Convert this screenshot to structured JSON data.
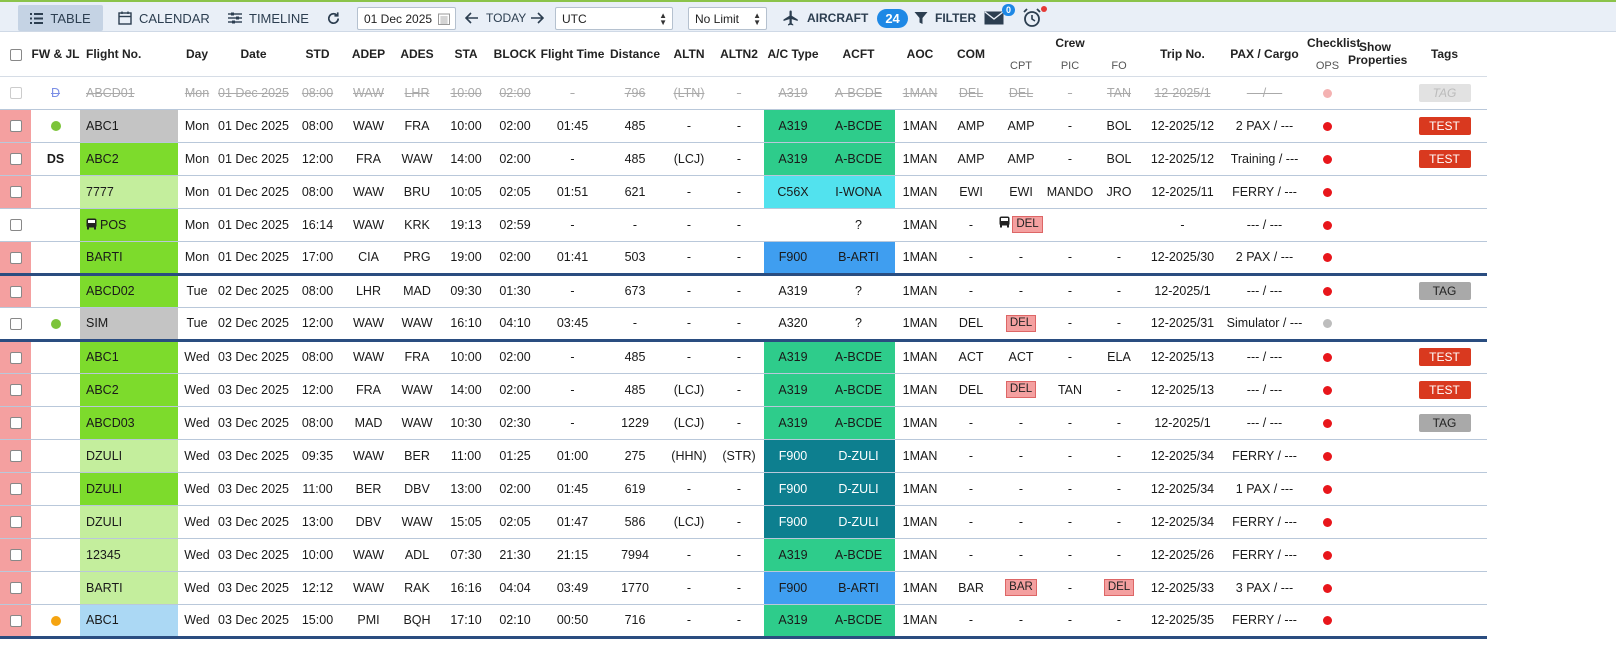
{
  "toolbar": {
    "table_label": "TABLE",
    "calendar_label": "CALENDAR",
    "timeline_label": "TIMELINE",
    "date_value": "01 Dec 2025",
    "today_label": "TODAY",
    "timezone_value": "UTC",
    "limit_value": "No Limit",
    "aircraft_label": "AIRCRAFT",
    "aircraft_count": "24",
    "filter_label": "FILTER",
    "mail_count": "0"
  },
  "headers": {
    "fwjl": "FW & JL",
    "flight": "Flight No.",
    "day": "Day",
    "date": "Date",
    "std": "STD",
    "adep": "ADEP",
    "ades": "ADES",
    "sta": "STA",
    "block": "BLOCK",
    "ftime": "Flight Time",
    "dist": "Distance",
    "altn": "ALTN",
    "altn2": "ALTN2",
    "actype": "A/C Type",
    "acft": "ACFT",
    "aoc": "AOC",
    "com": "COM",
    "crew": "Crew",
    "cpt": "CPT",
    "pic": "PIC",
    "fo": "FO",
    "trip": "Trip No.",
    "pax": "PAX / Cargo",
    "checklist": "Checklist",
    "ops": "OPS",
    "showprops": "Show Properties",
    "tags": "Tags"
  },
  "colors": {
    "flight_grey": "#c4c4c4",
    "flight_green": "#7ddb2c",
    "flight_lightgreen": "#c4ee9d",
    "flight_lightblue": "#abd8f4",
    "ac_green": "#2ecc8b",
    "ac_cyan": "#52e2ee",
    "ac_blue": "#3f9ef0",
    "ac_teal": "#0d7f8f",
    "status_red": "#e8161b",
    "status_grey": "#bdbdbd",
    "dot_green": "#7cc43a",
    "dot_orange": "#f5a410"
  },
  "rows": [
    {
      "sel": "white",
      "fw": "D",
      "fwtype": "text",
      "flight": "ABCD01",
      "fcolor": "none",
      "day": "Mon",
      "date": "01 Dec 2025",
      "std": "08:00",
      "adep": "WAW",
      "ades": "LHR",
      "sta": "10:00",
      "block": "02:00",
      "ftime": "-",
      "dist": "796",
      "altn": "(LTN)",
      "altn2": "-",
      "actype": "A319",
      "acft": "A-BCDE",
      "accolor": "none",
      "aoc": "1MAN",
      "com": "DEL",
      "cpt": "DEL",
      "pic": "-",
      "fo": "TAN",
      "trip": "12-2025/1",
      "pax": "--- / ---",
      "ck": "faint",
      "tag": "TAG",
      "tagtype": "faint",
      "cancelled": true,
      "end": false
    },
    {
      "sel": "red",
      "fw": "",
      "fwtype": "green",
      "flight": "ABC1",
      "fcolor": "grey",
      "day": "Mon",
      "date": "01 Dec 2025",
      "std": "08:00",
      "adep": "WAW",
      "ades": "FRA",
      "sta": "10:00",
      "block": "02:00",
      "ftime": "01:45",
      "dist": "485",
      "altn": "-",
      "altn2": "-",
      "actype": "A319",
      "acft": "A-BCDE",
      "accolor": "green",
      "aoc": "1MAN",
      "com": "AMP",
      "cpt": "AMP",
      "pic": "-",
      "fo": "BOL",
      "trip": "12-2025/12",
      "pax": "2 PAX / ---",
      "ck": "red",
      "tag": "TEST",
      "tagtype": "red",
      "end": false
    },
    {
      "sel": "red",
      "fw": "DS",
      "fwtype": "text",
      "flight": "ABC2",
      "fcolor": "green",
      "day": "Mon",
      "date": "01 Dec 2025",
      "std": "12:00",
      "adep": "FRA",
      "ades": "WAW",
      "sta": "14:00",
      "block": "02:00",
      "ftime": "-",
      "dist": "485",
      "altn": "(LCJ)",
      "altn2": "-",
      "actype": "A319",
      "acft": "A-BCDE",
      "accolor": "green",
      "aoc": "1MAN",
      "com": "AMP",
      "cpt": "AMP",
      "pic": "-",
      "fo": "BOL",
      "trip": "12-2025/12",
      "pax": "Training / ---",
      "ck": "red",
      "tag": "TEST",
      "tagtype": "red",
      "end": false
    },
    {
      "sel": "red",
      "fw": "",
      "fwtype": "none",
      "flight": "7777",
      "fcolor": "lightgreen",
      "day": "Mon",
      "date": "01 Dec 2025",
      "std": "08:00",
      "adep": "WAW",
      "ades": "BRU",
      "sta": "10:05",
      "block": "02:05",
      "ftime": "01:51",
      "dist": "621",
      "altn": "-",
      "altn2": "-",
      "actype": "C56X",
      "acft": "I-WONA",
      "accolor": "cyan",
      "aoc": "1MAN",
      "com": "EWI",
      "cpt": "EWI",
      "pic": "MANDO",
      "fo": "JRO",
      "trip": "12-2025/11",
      "pax": "FERRY / ---",
      "ck": "red",
      "tag": "",
      "tagtype": "none",
      "end": false
    },
    {
      "sel": "white",
      "fw": "",
      "fwtype": "none",
      "flight": "POS",
      "bus": true,
      "fcolor": "green",
      "day": "Mon",
      "date": "01 Dec 2025",
      "std": "16:14",
      "adep": "WAW",
      "ades": "KRK",
      "sta": "19:13",
      "block": "02:59",
      "ftime": "-",
      "dist": "-",
      "altn": "-",
      "altn2": "-",
      "actype": "",
      "acft": "?",
      "accolor": "none",
      "aoc": "1MAN",
      "com": "-",
      "cpt": "DEL",
      "cptbus": true,
      "cptdel": true,
      "pic": "",
      "fo": "",
      "trip": "-",
      "pax": "--- / ---",
      "ck": "red",
      "tag": "",
      "tagtype": "none",
      "end": false
    },
    {
      "sel": "red",
      "fw": "",
      "fwtype": "none",
      "flight": "BARTI",
      "fcolor": "green",
      "day": "Mon",
      "date": "01 Dec 2025",
      "std": "17:00",
      "adep": "CIA",
      "ades": "PRG",
      "sta": "19:00",
      "block": "02:00",
      "ftime": "01:41",
      "dist": "503",
      "altn": "-",
      "altn2": "-",
      "actype": "F900",
      "acft": "B-ARTI",
      "accolor": "blue",
      "aoc": "1MAN",
      "com": "-",
      "cpt": "-",
      "pic": "-",
      "fo": "-",
      "trip": "12-2025/30",
      "pax": "2 PAX / ---",
      "ck": "red",
      "tag": "",
      "tagtype": "none",
      "end": true
    },
    {
      "sel": "red",
      "fw": "",
      "fwtype": "none",
      "flight": "ABCD02",
      "fcolor": "green",
      "day": "Tue",
      "date": "02 Dec 2025",
      "std": "08:00",
      "adep": "LHR",
      "ades": "MAD",
      "sta": "09:30",
      "block": "01:30",
      "ftime": "-",
      "dist": "673",
      "altn": "-",
      "altn2": "-",
      "actype": "A319",
      "acft": "?",
      "accolor": "none",
      "aoc": "1MAN",
      "com": "-",
      "cpt": "-",
      "pic": "-",
      "fo": "-",
      "trip": "12-2025/1",
      "pax": "--- / ---",
      "ck": "red",
      "tag": "TAG",
      "tagtype": "grey",
      "end": false
    },
    {
      "sel": "white",
      "fw": "",
      "fwtype": "green",
      "flight": "SIM",
      "fcolor": "grey",
      "day": "Tue",
      "date": "02 Dec 2025",
      "std": "12:00",
      "adep": "WAW",
      "ades": "WAW",
      "sta": "16:10",
      "block": "04:10",
      "ftime": "03:45",
      "dist": "-",
      "altn": "-",
      "altn2": "-",
      "actype": "A320",
      "acft": "?",
      "accolor": "none",
      "aoc": "1MAN",
      "com": "DEL",
      "cpt": "DEL",
      "cptdel": true,
      "pic": "-",
      "fo": "-",
      "trip": "12-2025/31",
      "pax": "Simulator / ---",
      "ck": "grey",
      "tag": "",
      "tagtype": "none",
      "end": true
    },
    {
      "sel": "red",
      "fw": "",
      "fwtype": "none",
      "flight": "ABC1",
      "fcolor": "green",
      "day": "Wed",
      "date": "03 Dec 2025",
      "std": "08:00",
      "adep": "WAW",
      "ades": "FRA",
      "sta": "10:00",
      "block": "02:00",
      "ftime": "-",
      "dist": "485",
      "altn": "-",
      "altn2": "-",
      "actype": "A319",
      "acft": "A-BCDE",
      "accolor": "green",
      "aoc": "1MAN",
      "com": "ACT",
      "cpt": "ACT",
      "pic": "-",
      "fo": "ELA",
      "trip": "12-2025/13",
      "pax": "--- / ---",
      "ck": "red",
      "tag": "TEST",
      "tagtype": "red",
      "end": false
    },
    {
      "sel": "red",
      "fw": "",
      "fwtype": "none",
      "flight": "ABC2",
      "fcolor": "green",
      "day": "Wed",
      "date": "03 Dec 2025",
      "std": "12:00",
      "adep": "FRA",
      "ades": "WAW",
      "sta": "14:00",
      "block": "02:00",
      "ftime": "-",
      "dist": "485",
      "altn": "(LCJ)",
      "altn2": "-",
      "actype": "A319",
      "acft": "A-BCDE",
      "accolor": "green",
      "aoc": "1MAN",
      "com": "DEL",
      "cpt": "DEL",
      "cptdel": true,
      "pic": "TAN",
      "fo": "-",
      "trip": "12-2025/13",
      "pax": "--- / ---",
      "ck": "red",
      "tag": "TEST",
      "tagtype": "red",
      "end": false
    },
    {
      "sel": "red",
      "fw": "",
      "fwtype": "none",
      "flight": "ABCD03",
      "fcolor": "green",
      "day": "Wed",
      "date": "03 Dec 2025",
      "std": "08:00",
      "adep": "MAD",
      "ades": "WAW",
      "sta": "10:30",
      "block": "02:30",
      "ftime": "-",
      "dist": "1229",
      "altn": "(LCJ)",
      "altn2": "-",
      "actype": "A319",
      "acft": "A-BCDE",
      "accolor": "green",
      "aoc": "1MAN",
      "com": "-",
      "cpt": "-",
      "pic": "-",
      "fo": "-",
      "trip": "12-2025/1",
      "pax": "--- / ---",
      "ck": "red",
      "tag": "TAG",
      "tagtype": "grey",
      "end": false
    },
    {
      "sel": "red",
      "fw": "",
      "fwtype": "none",
      "flight": "DZULI",
      "fcolor": "lightgreen",
      "day": "Wed",
      "date": "03 Dec 2025",
      "std": "09:35",
      "adep": "WAW",
      "ades": "BER",
      "sta": "11:00",
      "block": "01:25",
      "ftime": "01:00",
      "dist": "275",
      "altn": "(HHN)",
      "altn2": "(STR)",
      "actype": "F900",
      "acft": "D-ZULI",
      "accolor": "teal",
      "aoc": "1MAN",
      "com": "-",
      "cpt": "-",
      "pic": "-",
      "fo": "-",
      "trip": "12-2025/34",
      "pax": "FERRY / ---",
      "ck": "red",
      "tag": "",
      "tagtype": "none",
      "end": false
    },
    {
      "sel": "red",
      "fw": "",
      "fwtype": "none",
      "flight": "DZULI",
      "fcolor": "green",
      "day": "Wed",
      "date": "03 Dec 2025",
      "std": "11:00",
      "adep": "BER",
      "ades": "DBV",
      "sta": "13:00",
      "block": "02:00",
      "ftime": "01:45",
      "dist": "619",
      "altn": "-",
      "altn2": "-",
      "actype": "F900",
      "acft": "D-ZULI",
      "accolor": "teal",
      "aoc": "1MAN",
      "com": "-",
      "cpt": "-",
      "pic": "-",
      "fo": "-",
      "trip": "12-2025/34",
      "pax": "1 PAX / ---",
      "ck": "red",
      "tag": "",
      "tagtype": "none",
      "end": false
    },
    {
      "sel": "red",
      "fw": "",
      "fwtype": "none",
      "flight": "DZULI",
      "fcolor": "lightgreen",
      "day": "Wed",
      "date": "03 Dec 2025",
      "std": "13:00",
      "adep": "DBV",
      "ades": "WAW",
      "sta": "15:05",
      "block": "02:05",
      "ftime": "01:47",
      "dist": "586",
      "altn": "(LCJ)",
      "altn2": "-",
      "actype": "F900",
      "acft": "D-ZULI",
      "accolor": "teal",
      "aoc": "1MAN",
      "com": "-",
      "cpt": "-",
      "pic": "-",
      "fo": "-",
      "trip": "12-2025/34",
      "pax": "FERRY / ---",
      "ck": "red",
      "tag": "",
      "tagtype": "none",
      "end": false
    },
    {
      "sel": "red",
      "fw": "",
      "fwtype": "none",
      "flight": "12345",
      "fcolor": "lightgreen",
      "day": "Wed",
      "date": "03 Dec 2025",
      "std": "10:00",
      "adep": "WAW",
      "ades": "ADL",
      "sta": "07:30",
      "block": "21:30",
      "ftime": "21:15",
      "dist": "7994",
      "altn": "-",
      "altn2": "-",
      "actype": "A319",
      "acft": "A-BCDE",
      "accolor": "green",
      "aoc": "1MAN",
      "com": "-",
      "cpt": "-",
      "pic": "-",
      "fo": "-",
      "trip": "12-2025/26",
      "pax": "FERRY / ---",
      "ck": "red",
      "tag": "",
      "tagtype": "none",
      "end": false
    },
    {
      "sel": "red",
      "fw": "",
      "fwtype": "none",
      "flight": "BARTI",
      "fcolor": "lightgreen",
      "day": "Wed",
      "date": "03 Dec 2025",
      "std": "12:12",
      "adep": "WAW",
      "ades": "RAK",
      "sta": "16:16",
      "block": "04:04",
      "ftime": "03:49",
      "dist": "1770",
      "altn": "-",
      "altn2": "-",
      "actype": "F900",
      "acft": "B-ARTI",
      "accolor": "blue",
      "aoc": "1MAN",
      "com": "BAR",
      "cpt": "BAR",
      "cptdel": true,
      "pic": "-",
      "fo": "DEL",
      "fodel": true,
      "trip": "12-2025/33",
      "pax": "3 PAX / ---",
      "ck": "red",
      "tag": "",
      "tagtype": "none",
      "end": false
    },
    {
      "sel": "red",
      "fw": "",
      "fwtype": "orange",
      "flight": "ABC1",
      "fcolor": "lightblue",
      "day": "Wed",
      "date": "03 Dec 2025",
      "std": "15:00",
      "adep": "PMI",
      "ades": "BQH",
      "sta": "17:10",
      "block": "02:10",
      "ftime": "00:50",
      "dist": "716",
      "altn": "-",
      "altn2": "-",
      "actype": "A319",
      "acft": "A-BCDE",
      "accolor": "green",
      "aoc": "1MAN",
      "com": "-",
      "cpt": "-",
      "pic": "-",
      "fo": "-",
      "trip": "12-2025/35",
      "pax": "FERRY / ---",
      "ck": "red",
      "tag": "",
      "tagtype": "none",
      "end": true
    }
  ]
}
